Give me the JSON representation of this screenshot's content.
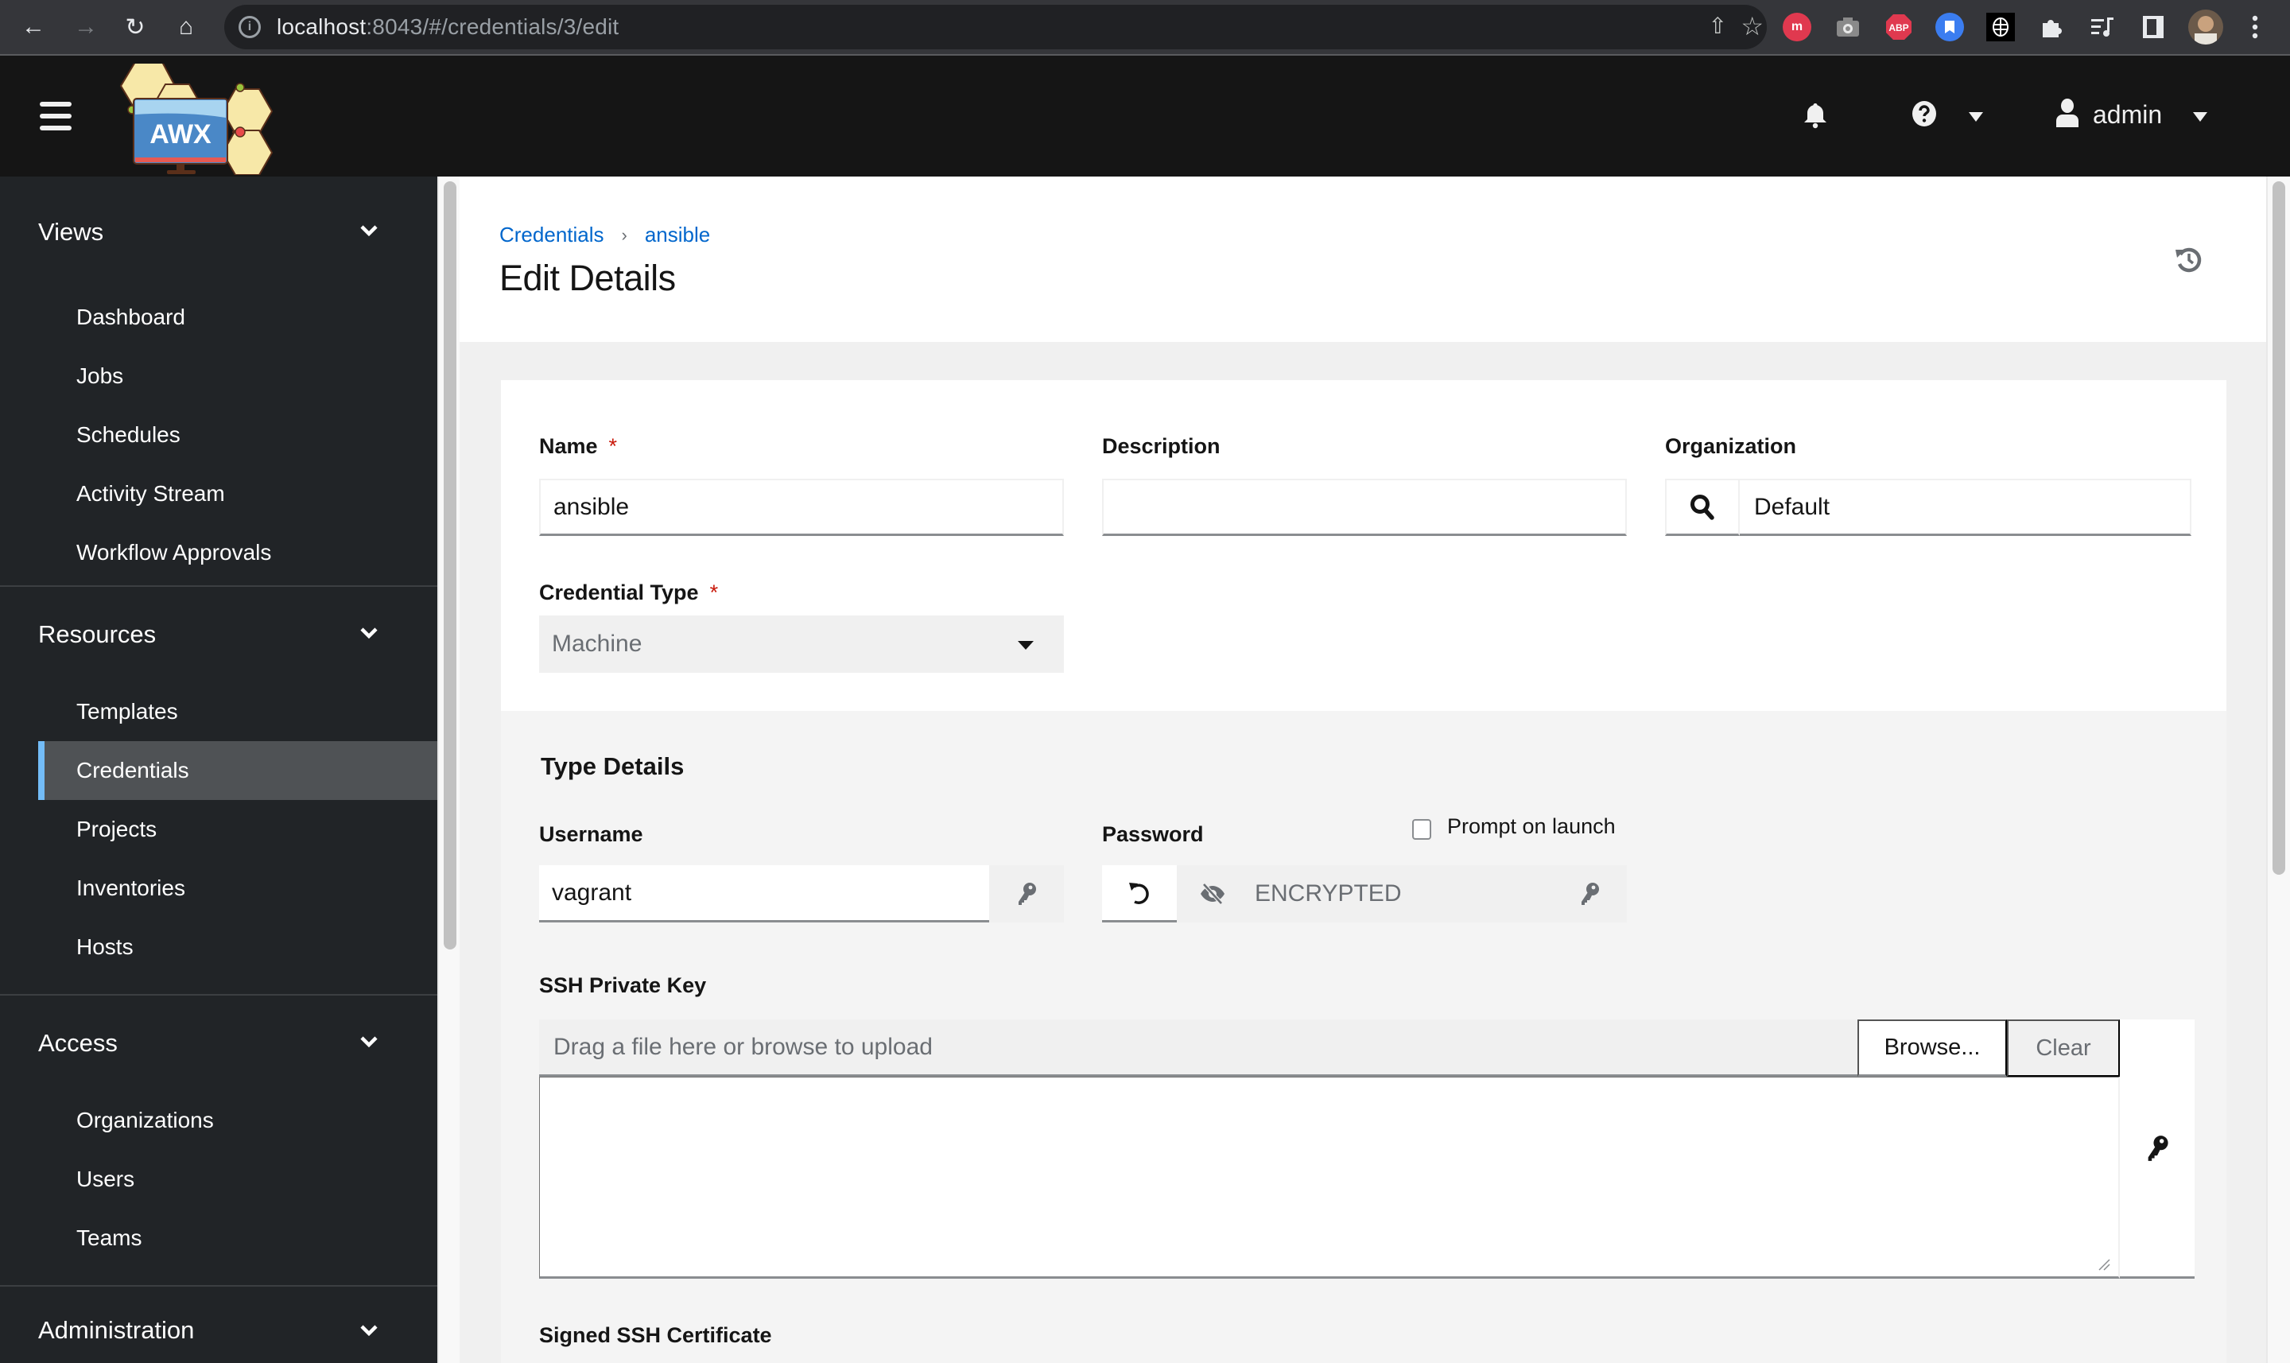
{
  "browser": {
    "url_host": "localhost",
    "url_path": ":8043/#/credentials/3/edit",
    "extensions": [
      {
        "name": "meetup-extension-icon",
        "label": "m",
        "color": "#e0394f"
      },
      {
        "name": "camera-extension-icon",
        "label": "",
        "color": "#8a8a8a"
      },
      {
        "name": "adblock-plus-icon",
        "label": "ABP",
        "color": "#e0394f"
      },
      {
        "name": "bookmark-extension-icon",
        "label": "",
        "color": "#3b7df0"
      },
      {
        "name": "shield-extension-icon",
        "label": "",
        "color": "#000000"
      }
    ]
  },
  "header": {
    "logo_text": "AWX",
    "user": "admin"
  },
  "sidebar": {
    "groups": [
      {
        "title": "Views",
        "items": [
          "Dashboard",
          "Jobs",
          "Schedules",
          "Activity Stream",
          "Workflow Approvals"
        ]
      },
      {
        "title": "Resources",
        "items": [
          "Templates",
          "Credentials",
          "Projects",
          "Inventories",
          "Hosts"
        ]
      },
      {
        "title": "Access",
        "items": [
          "Organizations",
          "Users",
          "Teams"
        ]
      },
      {
        "title": "Administration",
        "items": []
      }
    ],
    "active_item": "Credentials"
  },
  "page": {
    "breadcrumb": [
      "Credentials",
      "ansible"
    ],
    "title": "Edit Details"
  },
  "form": {
    "name_label": "Name",
    "name_value": "ansible",
    "description_label": "Description",
    "description_value": "",
    "organization_label": "Organization",
    "organization_value": "Default",
    "credential_type_label": "Credential Type",
    "credential_type_value": "Machine",
    "required_marker": "*",
    "type_details": {
      "title": "Type Details",
      "username_label": "Username",
      "username_value": "vagrant",
      "password_label": "Password",
      "password_value": "ENCRYPTED",
      "prompt_on_launch_label": "Prompt on launch",
      "prompt_on_launch_checked": false,
      "ssh_key_label": "SSH Private Key",
      "ssh_key_placeholder": "Drag a file here or browse to upload",
      "browse_label": "Browse...",
      "clear_label": "Clear",
      "signed_cert_label": "Signed SSH Certificate"
    }
  },
  "colors": {
    "link": "#0066cc",
    "active_nav_accent": "#73bcf7",
    "required": "#c9190b"
  }
}
